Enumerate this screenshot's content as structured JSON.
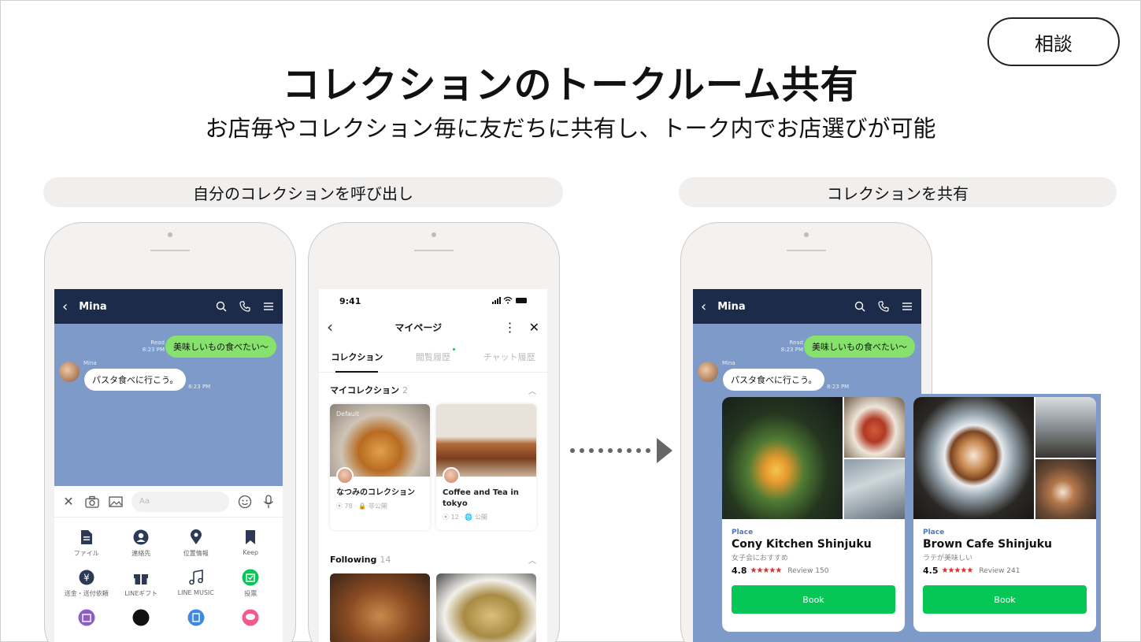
{
  "consult_button": "相談",
  "title": "コレクションのトークルーム共有",
  "subtitle": "お店毎やコレクション毎に友だちに共有し、トーク内でお店選びが可能",
  "section_left": "自分のコレクションを呼び出し",
  "section_right": "コレクションを共有",
  "chat": {
    "contact": "Mina",
    "read_label": "Read",
    "sent_time": "8:23 PM",
    "my_message": "美味しいもの食べたい〜",
    "friend_name": "Mina",
    "friend_message": "パスタ食べに行こう。",
    "friend_time": "8:23 PM",
    "input_placeholder": "Aa",
    "menu": [
      {
        "icon": "file-icon",
        "label": "ファイル"
      },
      {
        "icon": "contact-icon",
        "label": "連絡先"
      },
      {
        "icon": "location-icon",
        "label": "位置情報"
      },
      {
        "icon": "bookmark-icon",
        "label": "Keep"
      },
      {
        "icon": "yen-icon",
        "label": "送金・送付依頼"
      },
      {
        "icon": "gift-icon",
        "label": "LINEギフト"
      },
      {
        "icon": "music-icon",
        "label": "LINE MUSIC"
      },
      {
        "icon": "vote-icon",
        "label": "投票"
      }
    ]
  },
  "mypage": {
    "time": "9:41",
    "title": "マイページ",
    "tabs": [
      "コレクション",
      "閲覧履歴",
      "チャット履歴"
    ],
    "my_collection_label": "マイコレクション",
    "my_collection_count": "2",
    "cards": [
      {
        "tag": "Default",
        "title": "なつみのコレクション",
        "count": "78",
        "visibility": "非公開"
      },
      {
        "title": "Coffee and Tea in tokyo",
        "count": "12",
        "visibility": "公開"
      }
    ],
    "following_label": "Following",
    "following_count": "14"
  },
  "places": [
    {
      "type": "Place",
      "name": "Cony Kitchen Shinjuku",
      "desc": "女子会におすすめ",
      "rating": "4.8",
      "stars": "★★★★★",
      "reviews": "Review 150",
      "book": "Book"
    },
    {
      "type": "Place",
      "name": "Brown Cafe Shinjuku",
      "desc": "ラテが美味しい",
      "rating": "4.5",
      "stars": "★★★★★",
      "reviews": "Review 241",
      "book": "Book"
    }
  ],
  "colors": {
    "chat_header": "#1c2b4a",
    "chat_bg": "#7d9ac9",
    "my_bubble": "#86e26c",
    "line_green": "#06c755",
    "star": "#e02a2a"
  }
}
